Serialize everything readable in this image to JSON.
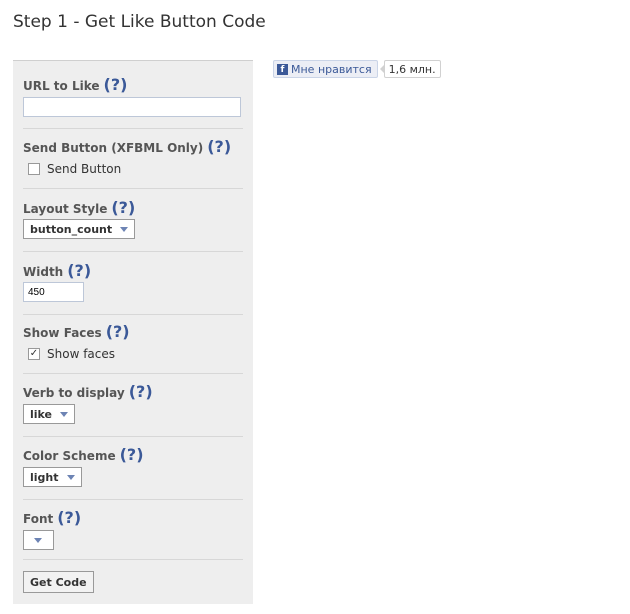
{
  "page": {
    "title": "Step 1 - Get Like Button Code"
  },
  "help_text": "(?)",
  "form": {
    "url": {
      "label": "URL to Like",
      "value": ""
    },
    "send": {
      "label": "Send Button (XFBML Only)",
      "checkbox_label": "Send Button",
      "checked": false
    },
    "layout": {
      "label": "Layout Style",
      "value": "button_count"
    },
    "width": {
      "label": "Width",
      "value": "450"
    },
    "faces": {
      "label": "Show Faces",
      "checkbox_label": "Show faces",
      "checked": true
    },
    "verb": {
      "label": "Verb to display",
      "value": "like"
    },
    "color": {
      "label": "Color Scheme",
      "value": "light"
    },
    "font": {
      "label": "Font",
      "value": ""
    },
    "submit_label": "Get Code"
  },
  "preview": {
    "like_label": "Мне нравится",
    "count": "1,6 млн.",
    "icon_letter": "f",
    "brand_color": "#3b5998"
  },
  "icons": {
    "checkmark": "✓"
  }
}
